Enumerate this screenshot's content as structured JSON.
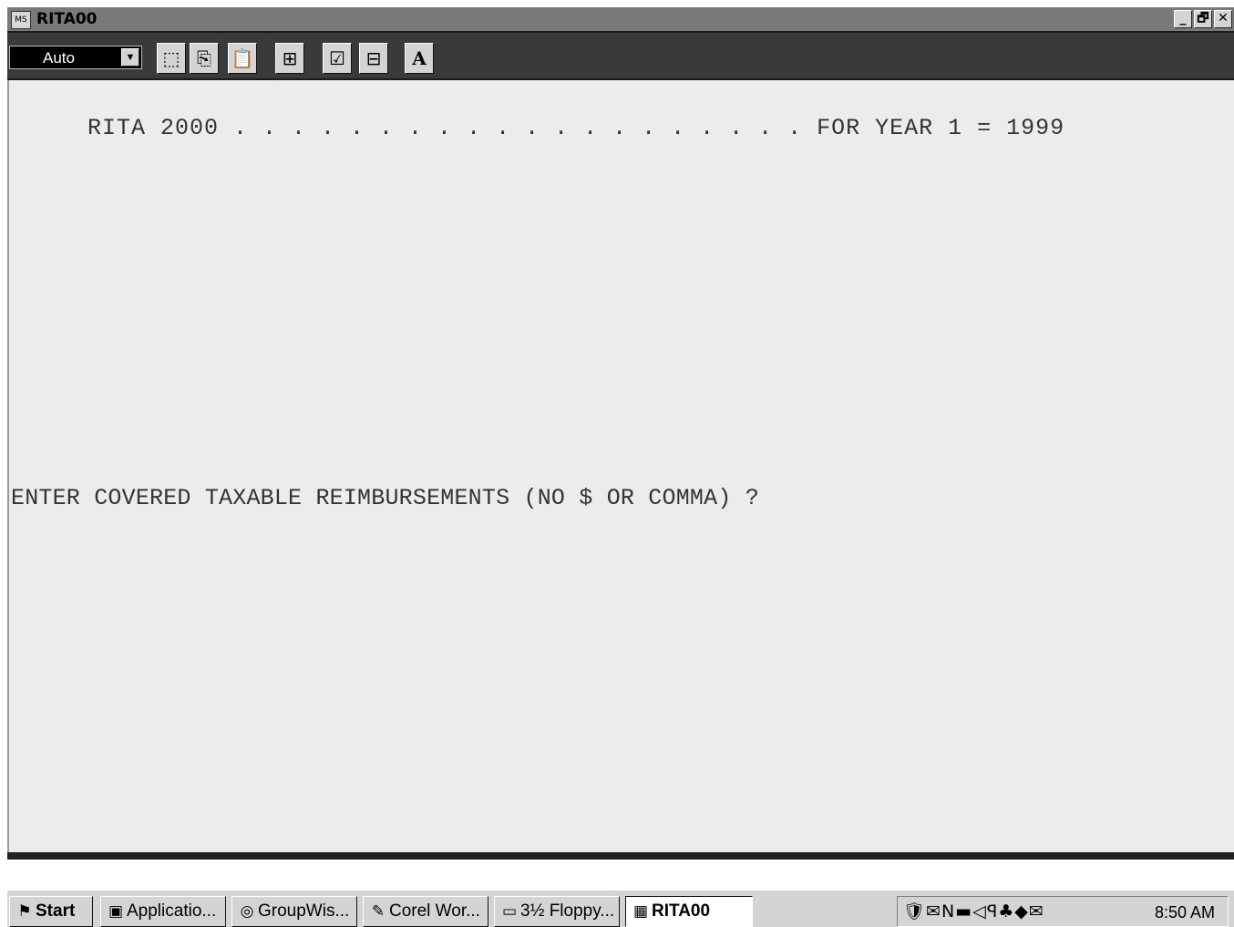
{
  "window": {
    "title": "RITA00",
    "icon_text": "MS"
  },
  "caption_buttons": {
    "minimize": "_",
    "restore": "🗗",
    "close": "✕"
  },
  "toolbar": {
    "font_size_value": "Auto",
    "buttons": [
      {
        "name": "mark-icon",
        "glyph": "⬚"
      },
      {
        "name": "copy-icon",
        "glyph": "⎘"
      },
      {
        "name": "paste-icon",
        "glyph": "📋"
      },
      {
        "name": "fullscreen-icon",
        "glyph": "⊞"
      },
      {
        "name": "properties-icon",
        "glyph": "☑"
      },
      {
        "name": "background-icon",
        "glyph": "⊟"
      },
      {
        "name": "font-icon",
        "glyph": "A"
      }
    ]
  },
  "console": {
    "line1": "RITA 2000 . . . . . . . . . . . . . . . . . . . . FOR YEAR 1 = 1999",
    "line2": "ENTER COVERED TAXABLE REIMBURSEMENTS (NO $ OR COMMA) ?"
  },
  "taskbar": {
    "start_label": "Start",
    "tasks": [
      {
        "label": "Applicatio...",
        "icon": "▣"
      },
      {
        "label": "GroupWis...",
        "icon": "◎"
      },
      {
        "label": "Corel Wor...",
        "icon": "✎"
      },
      {
        "label": "3½ Floppy...",
        "icon": "▭"
      },
      {
        "label": "RITA00",
        "icon": "▦",
        "active": true
      }
    ],
    "tray_icons": "🛡✉N▬◁ꟼ♣◆✉",
    "clock": "8:50 AM"
  }
}
